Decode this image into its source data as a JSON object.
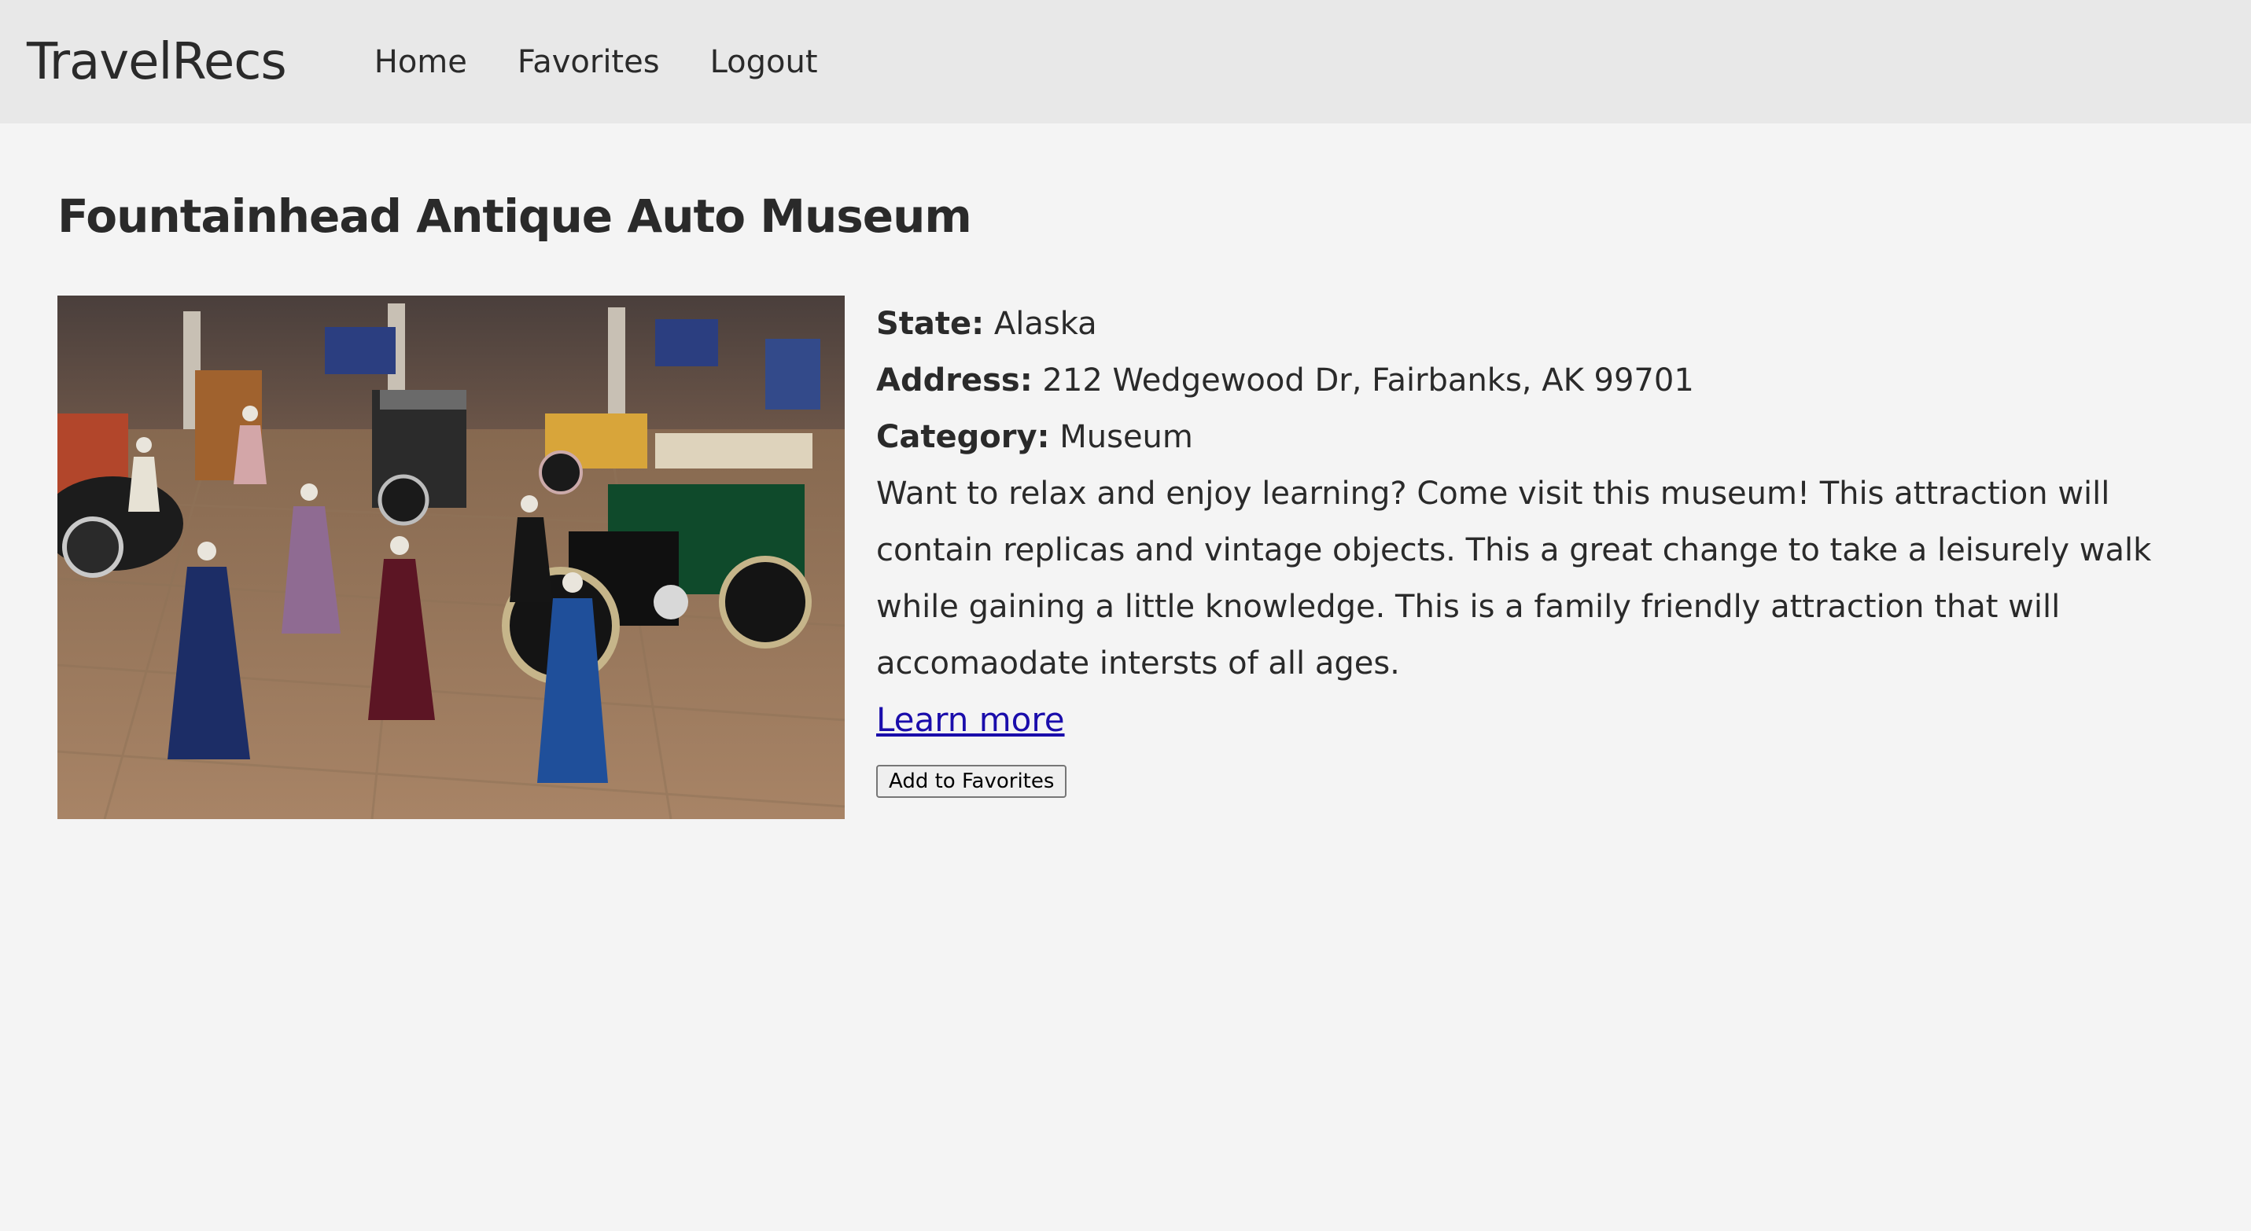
{
  "nav": {
    "brand": "TravelRecs",
    "links": [
      "Home",
      "Favorites",
      "Logout"
    ]
  },
  "attraction": {
    "title": "Fountainhead Antique Auto Museum",
    "image_alt": "Museum interior with vintage cars and period dresses on mannequins",
    "state_label": "State:",
    "state": "Alaska",
    "address_label": "Address:",
    "address": "212 Wedgewood Dr, Fairbanks, AK 99701",
    "category_label": "Category:",
    "category": "Museum",
    "description": "Want to relax and enjoy learning? Come visit this museum! This attraction will contain replicas and vintage objects. This a great change to take a leisurely walk while gaining a little knowledge. This is a family friendly attraction that will accomaodate intersts of all ages.",
    "learn_more": "Learn more",
    "add_favorite": "Add to Favorites"
  },
  "colors": {
    "navbar_bg": "#e8e8e8",
    "page_bg": "#f4f4f4",
    "link": "#1a0dab"
  }
}
